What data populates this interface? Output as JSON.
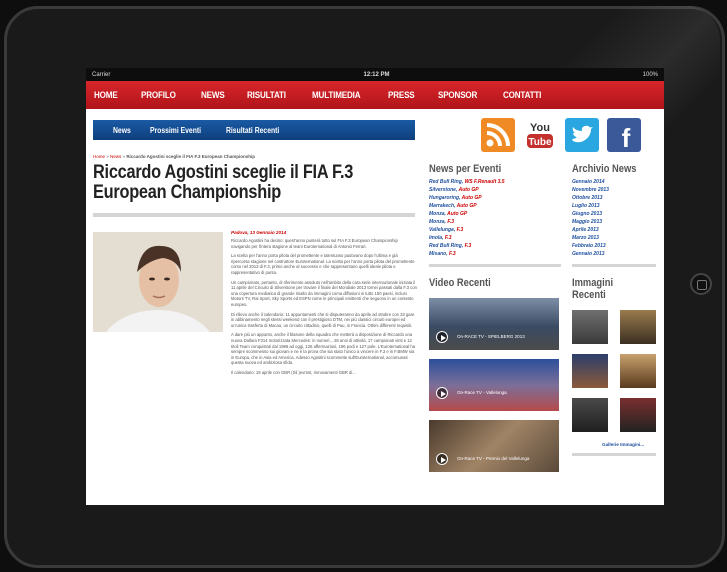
{
  "status": {
    "carrier": "Carrier",
    "time": "12:12 PM",
    "battery": "100%"
  },
  "nav": [
    "HOME",
    "PROFILO",
    "NEWS",
    "RISULTATI",
    "MULTIMEDIA",
    "PRESS",
    "SPONSOR",
    "CONTATTI"
  ],
  "subnav": [
    "News",
    "Prossimi Eventi",
    "Risultati Recenti"
  ],
  "breadcrumb": {
    "home": "Home",
    "section": "News",
    "current": "Riccardo Agostini sceglie il FIA F.3 European Championship"
  },
  "headline": "Riccardo Agostini sceglie il FIA F.3 European Championship",
  "article": {
    "dateline": "Padova, 13 Gennaio 2014",
    "paragraphs": [
      "Riccardo Agostini ha deciso: quest'anno punterà tutto sul FIA F.3 European Championship navigando per l'intera stagione al team Euroternational di Antonio Ferrari.",
      "La scelta per l'anno porta pilota del promettente e talentuoso padovano dopo l'ultima e già ripercorsa stagione nel costruttore Euroternational. La scelta per l'anno porta pilota del promettente corso nel 2013 di F.3, primo anche al successo e che rappresentano quelli ideale pilota e rappresentativo di punta.",
      "Un campionato, pertanto, di riferimento assoluto nell'ambito della cara serie internazionale iniziata il 11 aprile del Circuito di Silverstone per trovare il finale del Mondiale 2013 tornei passati dalla F.3 con una copertura mediatica di grande risalto da immagini coma diffusioni in tutto 150 paesi, inclusi Motors TV, Rai Sport, Sky Sports ed ESPN come le principali emittenti che seguono in un contesto europeo.",
      "Di rilievo anche il calendario: 11 appuntamenti che si disputeranno da aprile ad ottobre con 33 gare in abbinamento negli stessi weekend con il prestigioso DTM, nei più classici circuiti europei ed un'unica trasferta di Macao, un circuito cittadino, quelli di Pau, in Francia. Ottimi differenti requisiti.",
      "A dare più un appunto, anche il blasone della squadra che metterà a disposizione di Riccardo una nuova Dallara F314 motorizzata Mercedes: in numeri... 28 anni di attività, 17 campionati vinti e 12 titoli Team conquistati dal 1986 ad oggi, 126 affermazioni, 196 podi e 127 pole. L'Euroternational ha sempre scommesso sui giovani e ne è la prova che sia stato l'unico a vincere in F.3 e in F.BMW sia in Europa, che in Asia ed America. Adesso Agostini scommette sull'Euroternational, accomunati questa nuova ed ambiziosa sfida.",
      "Il calendario: 19 aprile con GBR (Sil.)evrnst, rinnovamenti GBR di..."
    ]
  },
  "social": {
    "rss": "rss-feed-icon",
    "youtube_top": "You",
    "youtube_bottom": "Tube",
    "twitter": "twitter-bird-icon",
    "facebook": "f"
  },
  "news_eventi": {
    "title": "News per Eventi",
    "items": [
      {
        "event": "Red Bull Ring,",
        "series": "WS F.Renault 3.5"
      },
      {
        "event": "Silverstone,",
        "series": "Auto GP"
      },
      {
        "event": "Hungaroring,",
        "series": "Auto GP"
      },
      {
        "event": "Marrakech,",
        "series": "Auto GP"
      },
      {
        "event": "Monza,",
        "series": "Auto GP"
      },
      {
        "event": "Monza,",
        "series": "F.3"
      },
      {
        "event": "Vallelunga,",
        "series": "F.3"
      },
      {
        "event": "Imola,",
        "series": "F.3"
      },
      {
        "event": "Red Bull Ring,",
        "series": "F.3"
      },
      {
        "event": "Misano,",
        "series": "F.3"
      }
    ]
  },
  "archivio": {
    "title": "Archivio News",
    "items": [
      "Gennaio 2014",
      "Novembre 2013",
      "Ottobre 2013",
      "Luglio 2013",
      "Giugno 2013",
      "Maggio 2013",
      "Aprile 2013",
      "Marzo 2013",
      "Febbraio 2013",
      "Gennaio 2013"
    ]
  },
  "video_recenti": {
    "title": "Video Recenti",
    "items": [
      "On-RACE TV - SPIELBERG 2013",
      "On-Race TV - Vallelunga",
      "On-Race TV - Premio del Vallelunga"
    ]
  },
  "immagini_recenti": {
    "title": "Immagini Recenti",
    "gallery_link": "Gallerie Immagini..."
  },
  "colors": {
    "nav_red": "#c8181e",
    "subnav_blue": "#114a8f",
    "link_blue": "#1d4f9e",
    "accent_red": "#cc0000"
  }
}
